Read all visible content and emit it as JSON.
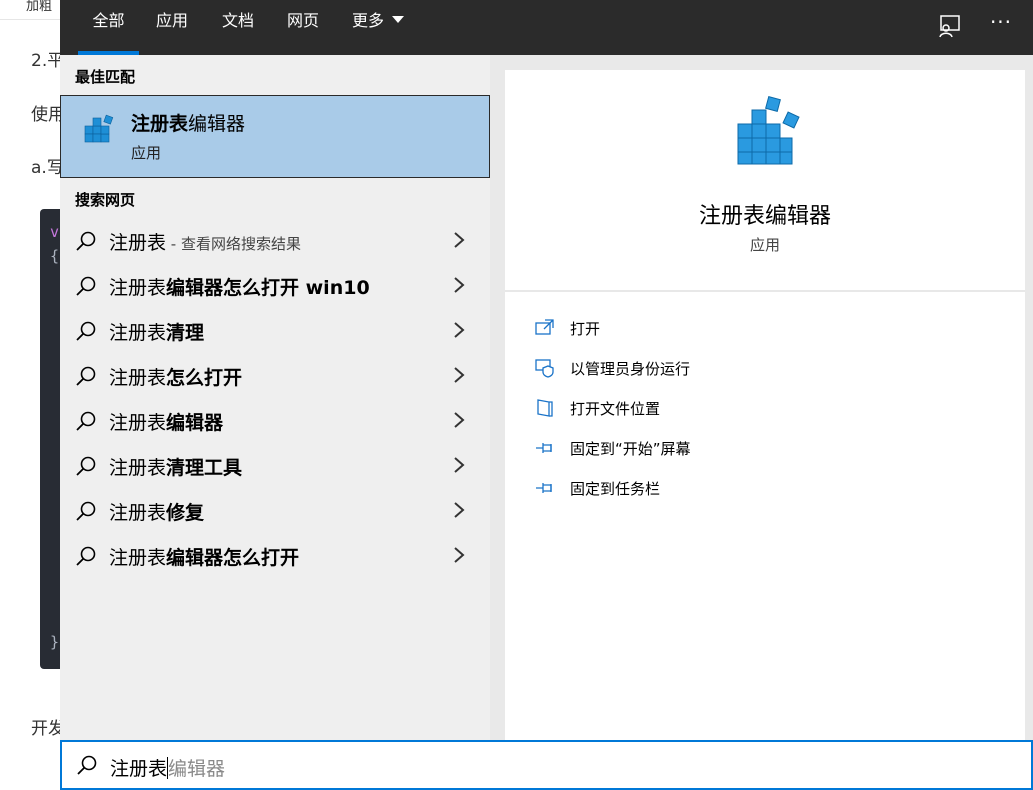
{
  "background": {
    "top_text": "加粗",
    "lines": [
      "2.平",
      "使用",
      "a.写",
      "开发"
    ],
    "code_chars": [
      "v",
      "{",
      "}"
    ]
  },
  "tabs": [
    {
      "label": "全部",
      "active": true
    },
    {
      "label": "应用"
    },
    {
      "label": "文档"
    },
    {
      "label": "网页"
    },
    {
      "label": "更多"
    }
  ],
  "icons": {
    "feedback": "feedback-icon",
    "more": "more-options-icon",
    "search": "search-icon",
    "chevron": "chevron-right-icon",
    "app": "registry-editor-icon"
  },
  "left": {
    "best_match_title": "最佳匹配",
    "best_match": {
      "name_bold": "注册表",
      "name_rest": "编辑器",
      "type": "应用"
    },
    "web_title": "搜索网页",
    "web_items": [
      {
        "prefix": "注册表",
        "bold": "",
        "hint": " - 查看网络搜索结果"
      },
      {
        "prefix": "注册表",
        "bold": "编辑器怎么打开 win10",
        "hint": ""
      },
      {
        "prefix": "注册表",
        "bold": "清理",
        "hint": ""
      },
      {
        "prefix": "注册表",
        "bold": "怎么打开",
        "hint": ""
      },
      {
        "prefix": "注册表",
        "bold": "编辑器",
        "hint": ""
      },
      {
        "prefix": "注册表",
        "bold": "清理工具",
        "hint": ""
      },
      {
        "prefix": "注册表",
        "bold": "修复",
        "hint": ""
      },
      {
        "prefix": "注册表",
        "bold": "编辑器怎么打开",
        "hint": ""
      }
    ]
  },
  "right": {
    "app_name": "注册表编辑器",
    "app_type": "应用",
    "actions": [
      {
        "label": "打开",
        "icon": "open-icon"
      },
      {
        "label": "以管理员身份运行",
        "icon": "shield-icon"
      },
      {
        "label": "打开文件位置",
        "icon": "file-location-icon"
      },
      {
        "label": "固定到“开始”屏幕",
        "icon": "pin-icon"
      },
      {
        "label": "固定到任务栏",
        "icon": "pin-icon"
      }
    ]
  },
  "search": {
    "typed": "注册表",
    "suggestion": "编辑器"
  },
  "colors": {
    "accent": "#0078d7",
    "selected": "#a9cbe8",
    "topbar": "#2b2b2b"
  }
}
